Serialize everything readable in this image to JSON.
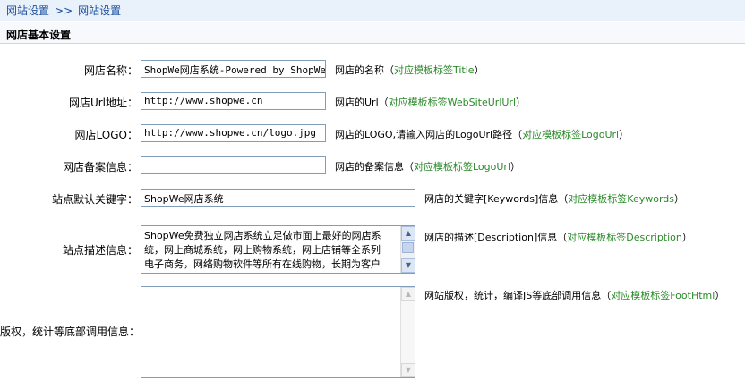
{
  "breadcrumb": {
    "item1": "网站设置",
    "sep": ">>",
    "item2": "网站设置"
  },
  "section": {
    "title": "网店基本设置"
  },
  "fields": {
    "store_name": {
      "label": "网店名称：",
      "value": "ShopWe网店系统-Powered by ShopWe",
      "hint": "网店的名称（",
      "tag": "对应模板标签Title",
      "hint_end": "）"
    },
    "store_url": {
      "label": "网店Url地址：",
      "value": "http://www.shopwe.cn",
      "hint": "网店的Url（",
      "tag": "对应模板标签WebSiteUrlUrl",
      "hint_end": "）"
    },
    "store_logo": {
      "label": "网店LOGO：",
      "value": "http://www.shopwe.cn/logo.jpg",
      "hint": "网店的LOGO,请输入网店的LogoUrl路径（",
      "tag": "对应模板标签LogoUrl",
      "hint_end": "）"
    },
    "store_icp": {
      "label": "网店备案信息：",
      "value": "",
      "hint": "网店的备案信息（",
      "tag": "对应模板标签LogoUrl",
      "hint_end": "）"
    },
    "keywords": {
      "label": "站点默认关键字：",
      "value": "ShopWe网店系统",
      "hint": "网店的关键字[Keywords]信息（",
      "tag": "对应模板标签Keywords",
      "hint_end": "）"
    },
    "description": {
      "label": "站点描述信息：",
      "lines": [
        "ShopWe免费独立网店系统立足做市面上最好的网店系",
        "统，网上商城系统，网上购物系统，网上店铺等全系列",
        "电子商务，网络购物软件等所有在线购物，长期为客户"
      ],
      "hint": "网店的描述[Description]信息（",
      "tag": "对应模板标签Description",
      "hint_end": "）"
    },
    "footer": {
      "label": "版权，统计等底部调用信息：",
      "value": "",
      "hint": "网站版权，统计，编译JS等底部调用信息（",
      "tag": "对应模板标签FootHtml",
      "hint_end": "）"
    }
  },
  "colors": {
    "tag_green": "#2a8a2a",
    "link_blue": "#1c4f9c",
    "border": "#7f9db9"
  }
}
